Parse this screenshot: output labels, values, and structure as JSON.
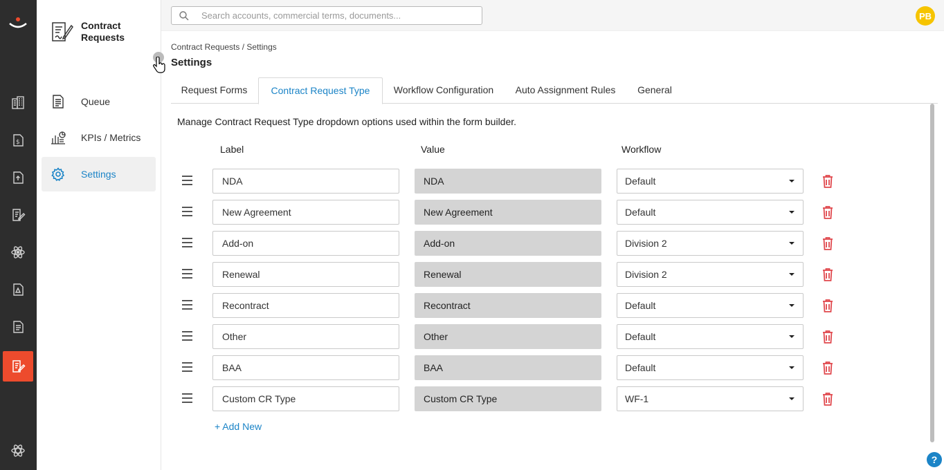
{
  "app": {
    "title": "Contract Requests"
  },
  "sidebar": {
    "items": [
      {
        "label": "Queue",
        "icon": "document-icon"
      },
      {
        "label": "KPIs / Metrics",
        "icon": "chart-icon"
      },
      {
        "label": "Settings",
        "icon": "gear-icon",
        "active": true
      }
    ]
  },
  "search": {
    "placeholder": "Search accounts, commercial terms, documents..."
  },
  "user": {
    "initials": "PB"
  },
  "breadcrumb": "Contract Requests / Settings",
  "page_title": "Settings",
  "tabs": [
    {
      "label": "Request Forms"
    },
    {
      "label": "Contract Request Type",
      "active": true
    },
    {
      "label": "Workflow Configuration"
    },
    {
      "label": "Auto Assignment Rules"
    },
    {
      "label": "General"
    }
  ],
  "description": "Manage Contract Request Type dropdown options used within the form builder.",
  "columns": {
    "label": "Label",
    "value": "Value",
    "workflow": "Workflow"
  },
  "rows": [
    {
      "label": "NDA",
      "value": "NDA",
      "workflow": "Default"
    },
    {
      "label": "New Agreement",
      "value": "New Agreement",
      "workflow": "Default"
    },
    {
      "label": "Add-on",
      "value": "Add-on",
      "workflow": "Division 2"
    },
    {
      "label": "Renewal",
      "value": "Renewal",
      "workflow": "Division 2"
    },
    {
      "label": "Recontract",
      "value": "Recontract",
      "workflow": "Default"
    },
    {
      "label": "Other",
      "value": "Other",
      "workflow": "Default"
    },
    {
      "label": "BAA",
      "value": "BAA",
      "workflow": "Default"
    },
    {
      "label": "Custom CR Type",
      "value": "Custom CR Type",
      "workflow": "WF-1"
    }
  ],
  "add_new": "+ Add New",
  "help": "?",
  "colors": {
    "accent": "#1b84c7",
    "brand": "#ed4b2d",
    "danger": "#e0474c",
    "rail": "#2d2d2d"
  }
}
